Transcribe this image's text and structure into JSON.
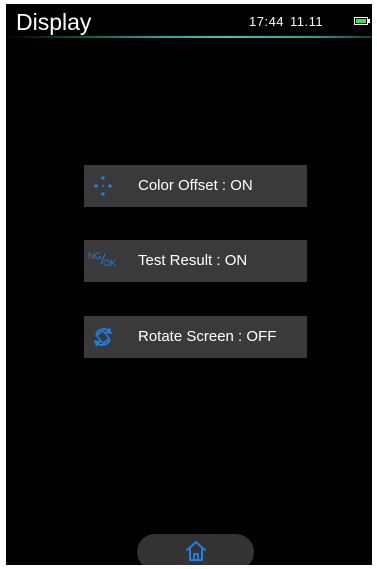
{
  "header": {
    "title": "Display",
    "time": "17:44",
    "date": "11.11"
  },
  "colors": {
    "accent": "#1a7fe8",
    "button_bg": "#3a3a3a",
    "battery": "#2ee84a",
    "divider": "#19a38f"
  },
  "menu": {
    "items": [
      {
        "label": "Color Offset : ON",
        "icon": "dots-icon"
      },
      {
        "label": "Test Result : ON",
        "icon": "ng-ok-icon",
        "icon_text_top": "NG",
        "icon_text_bottom": "OK"
      },
      {
        "label": "Rotate Screen : OFF",
        "icon": "rotate-screen-icon"
      }
    ]
  },
  "footer": {
    "home_icon": "home-icon"
  }
}
